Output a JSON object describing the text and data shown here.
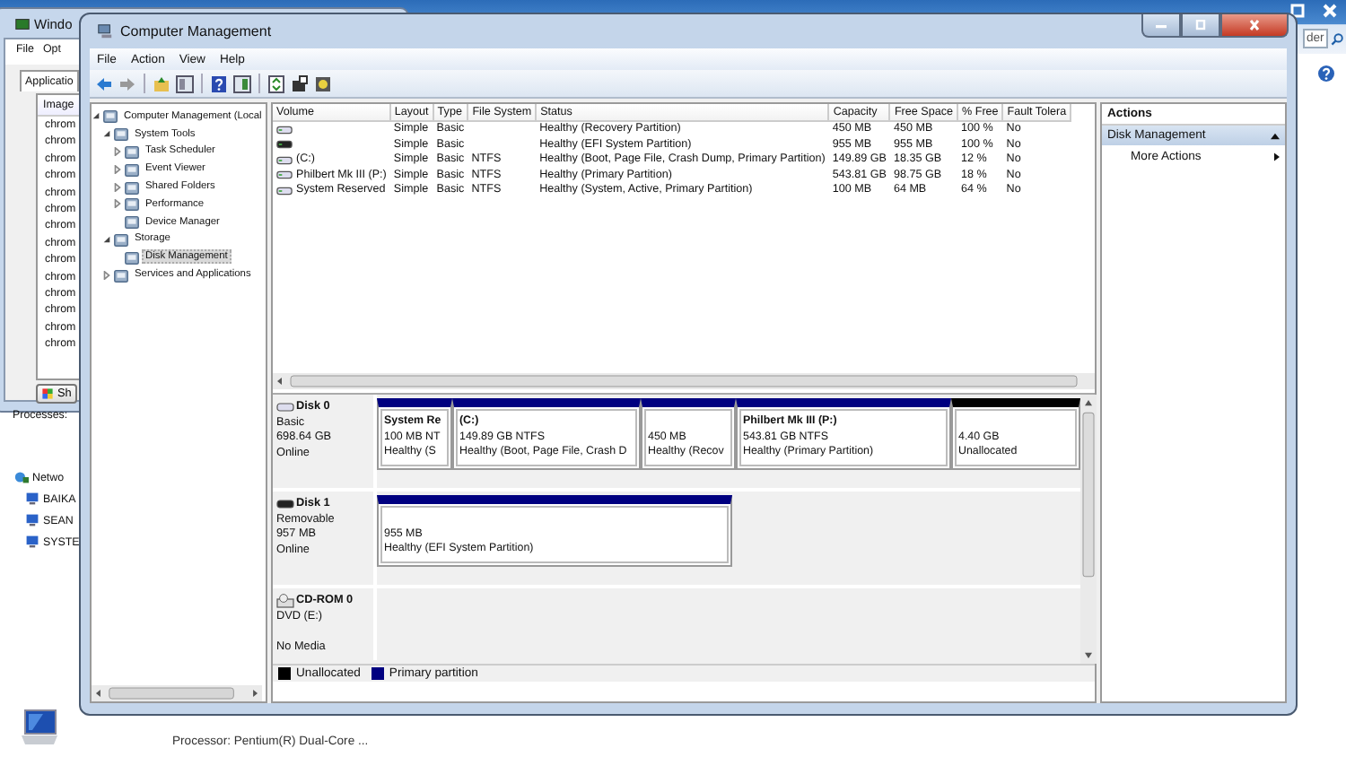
{
  "background": {
    "search": {
      "placeholder": "der"
    },
    "network": {
      "label": "Netwo",
      "items": [
        "BAIKA",
        "SEAN",
        "SYSTE"
      ]
    },
    "processor": "Processor: Pentium(R) Dual-Core ..."
  },
  "task_manager": {
    "title": "Windo",
    "menu": [
      "File",
      "Opt"
    ],
    "tab": "Applicatio",
    "column": "Image",
    "rows": [
      "chrom",
      "chrom",
      "chrom",
      "chrom",
      "chrom",
      "chrom",
      "chrom",
      "chrom",
      "chrom",
      "chrom",
      "chrom",
      "chrom",
      "chrom",
      "chrom"
    ],
    "button": "Sh",
    "status": "Processes:"
  },
  "window": {
    "title": "Computer Management"
  },
  "menu": [
    "File",
    "Action",
    "View",
    "Help"
  ],
  "tree": [
    {
      "label": "Computer Management (Local",
      "expanded": true,
      "selected": false,
      "children": [
        {
          "label": "System Tools",
          "expanded": true,
          "selected": false,
          "children": [
            {
              "label": "Task Scheduler",
              "expanded": false,
              "selected": false
            },
            {
              "label": "Event Viewer",
              "expanded": false,
              "selected": false
            },
            {
              "label": "Shared Folders",
              "expanded": false,
              "selected": false
            },
            {
              "label": "Performance",
              "expanded": false,
              "selected": false
            },
            {
              "label": "Device Manager",
              "selected": false
            }
          ]
        },
        {
          "label": "Storage",
          "expanded": true,
          "selected": false,
          "children": [
            {
              "label": "Disk Management",
              "selected": true
            }
          ]
        },
        {
          "label": "Services and Applications",
          "expanded": false,
          "selected": false
        }
      ]
    }
  ],
  "table": {
    "columns": [
      "Volume",
      "Layout",
      "Type",
      "File System",
      "Status",
      "Capacity",
      "Free Space",
      "% Free",
      "Fault Tolera"
    ],
    "rows": [
      [
        "",
        "Simple",
        "Basic",
        "",
        "Healthy (Recovery Partition)",
        "450 MB",
        "450 MB",
        "100 %",
        "No"
      ],
      [
        "",
        "Simple",
        "Basic",
        "",
        "Healthy (EFI System Partition)",
        "955 MB",
        "955 MB",
        "100 %",
        "No"
      ],
      [
        "(C:)",
        "Simple",
        "Basic",
        "NTFS",
        "Healthy (Boot, Page File, Crash Dump, Primary Partition)",
        "149.89 GB",
        "18.35 GB",
        "12 %",
        "No"
      ],
      [
        "Philbert Mk III (P:)",
        "Simple",
        "Basic",
        "NTFS",
        "Healthy (Primary Partition)",
        "543.81 GB",
        "98.75 GB",
        "18 %",
        "No"
      ],
      [
        "System Reserved",
        "Simple",
        "Basic",
        "NTFS",
        "Healthy (System, Active, Primary Partition)",
        "100 MB",
        "64 MB",
        "64 %",
        "No"
      ]
    ]
  },
  "disks": [
    {
      "kind": "disk",
      "name": "Disk 0",
      "type": "Basic",
      "size": "698.64 GB",
      "status": "Online",
      "partitions": [
        {
          "kind": "primary",
          "name": "System Re",
          "size": "100 MB NT",
          "status": "Healthy (S"
        },
        {
          "kind": "primary",
          "name": "(C:)",
          "size": "149.89 GB NTFS",
          "status": "Healthy (Boot, Page File, Crash D"
        },
        {
          "kind": "primary",
          "size": "450 MB",
          "status": "Healthy (Recov"
        },
        {
          "kind": "primary",
          "name": "Philbert Mk III  (P:)",
          "size": "543.81 GB NTFS",
          "status": "Healthy (Primary Partition)"
        },
        {
          "kind": "unallocated",
          "size": "4.40 GB",
          "status": "Unallocated"
        }
      ]
    },
    {
      "kind": "removable",
      "name": "Disk 1",
      "type": "Removable",
      "size": "957 MB",
      "status": "Online",
      "partitions": [
        {
          "kind": "primary",
          "size": "955 MB",
          "status": "Healthy (EFI System Partition)"
        }
      ]
    },
    {
      "kind": "cdrom",
      "name": "CD-ROM 0",
      "type": "DVD (E:)",
      "status": "No Media"
    }
  ],
  "legend": [
    {
      "label": "Unallocated",
      "color": "#000000"
    },
    {
      "label": "Primary partition",
      "color": "#000080"
    }
  ],
  "actions": {
    "title": "Actions",
    "sections": [
      {
        "label": "Disk Management",
        "expanded": true,
        "items": [
          "More Actions"
        ]
      }
    ]
  }
}
